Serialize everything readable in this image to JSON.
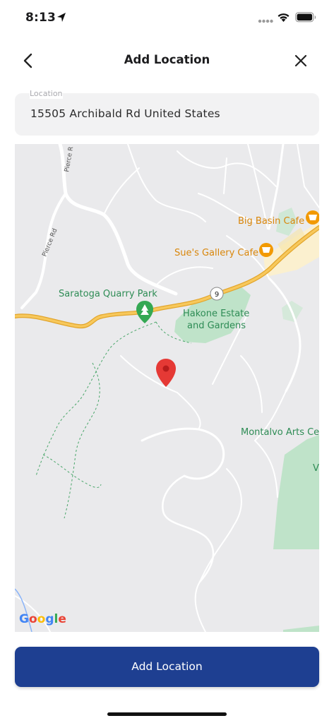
{
  "status_bar": {
    "time": "8:13"
  },
  "header": {
    "title": "Add Location",
    "back_icon": "chevron-left-icon",
    "close_icon": "close-icon"
  },
  "location_field": {
    "label": "Location",
    "value": "15505 Archibald Rd United States"
  },
  "map": {
    "labels": {
      "saratoga_quarry_park": "Saratoga Quarry Park",
      "hakone_line1": "Hakone Estate",
      "hakone_line2": "and Gardens",
      "big_basin_cafe": "Big Basin Cafe",
      "sues_gallery_cafe": "Sue's Gallery Cafe",
      "montalvo": "Montalvo Arts Cen",
      "pierce_rd": "Pierce Rd",
      "pierce_rd_top": "Pierce R",
      "route": "9",
      "edge_v": "V"
    },
    "google_logo": "Google",
    "colors": {
      "park": "#bfe3c9",
      "road_major": "#f4bb3c",
      "water": "#8ab4f8",
      "marker": "#e53935"
    }
  },
  "primary_button": {
    "label": "Add Location",
    "color": "#1e3f91"
  }
}
